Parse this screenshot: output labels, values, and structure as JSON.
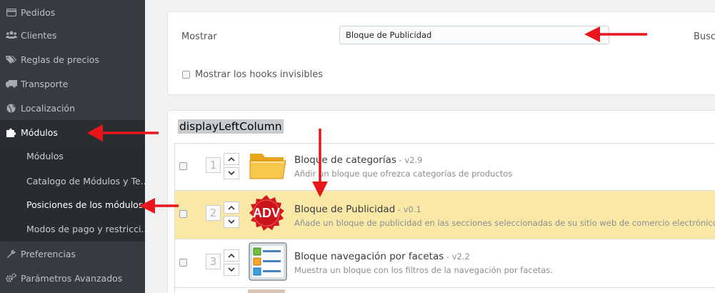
{
  "sidebar": {
    "items": [
      {
        "label": "Pedidos",
        "icon": "credit-card-icon"
      },
      {
        "label": "Clientes",
        "icon": "users-icon"
      },
      {
        "label": "Reglas de precios",
        "icon": "tags-icon"
      },
      {
        "label": "Transporte",
        "icon": "truck-icon"
      },
      {
        "label": "Localización",
        "icon": "globe-icon"
      },
      {
        "label": "Módulos",
        "icon": "puzzle-icon"
      },
      {
        "label": "Preferencias",
        "icon": "wrench-icon"
      },
      {
        "label": "Parámetros Avanzados",
        "icon": "cogs-icon"
      }
    ],
    "subitems": [
      {
        "label": "Módulos"
      },
      {
        "label": "Catalogo de Módulos y Te..."
      },
      {
        "label": "Posiciones de los módulos"
      },
      {
        "label": "Modos de pago y restricci..."
      }
    ]
  },
  "filters": {
    "show_label": "Mostrar",
    "selected_module": "Bloque de Publicidad",
    "search_label": "Busc",
    "invisible_hooks_label": "Mostrar los hooks invisibles"
  },
  "hook": {
    "name": "displayLeftColumn",
    "modules": [
      {
        "position": "1",
        "name": "Bloque de categorías",
        "version": " - v2.9",
        "description": "Añdir un bloque que ofrezca categorías de productos",
        "icon": "folder-icon"
      },
      {
        "position": "2",
        "name": "Bloque de Publicidad",
        "version": " - v0.1",
        "description": "Añade un bloque de publicidad en las secciones seleccionadas de su sitio web de comercio electrónico.",
        "icon": "adv-badge-icon",
        "icon_text": "ADV"
      },
      {
        "position": "3",
        "name": "Bloque navegación por facetas",
        "version": " - v2.2",
        "description": "Muestra un bloque con los filtros de la navegación por facetas.",
        "icon": "facets-list-icon"
      }
    ]
  },
  "colors": {
    "sidebar_bg": "#363a41",
    "highlight_row": "#f9e8a6",
    "annotation_arrow": "#e8161b",
    "adv_badge": "#d3171c"
  }
}
